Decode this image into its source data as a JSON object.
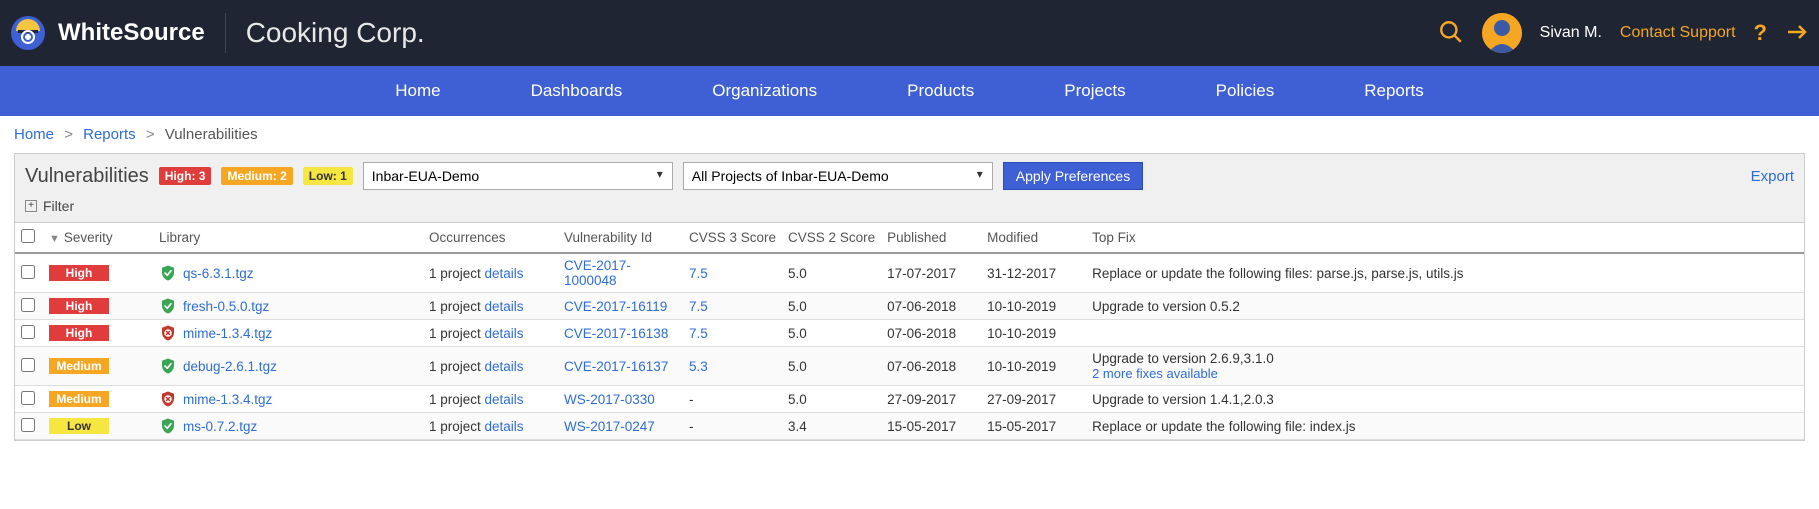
{
  "topbar": {
    "brand": "WhiteSource",
    "org": "Cooking Corp.",
    "username": "Sivan M.",
    "contact": "Contact Support"
  },
  "nav": {
    "items": [
      "Home",
      "Dashboards",
      "Organizations",
      "Products",
      "Projects",
      "Policies",
      "Reports"
    ]
  },
  "breadcrumb": {
    "items": [
      "Home",
      "Reports",
      "Vulnerabilities"
    ]
  },
  "header": {
    "title": "Vulnerabilities",
    "sev_counts": {
      "high": "High: 3",
      "medium": "Medium: 2",
      "low": "Low: 1"
    },
    "select_product": "Inbar-EUA-Demo",
    "select_project": "All Projects of Inbar-EUA-Demo",
    "apply": "Apply Preferences",
    "export": "Export",
    "filter": "Filter"
  },
  "columns": {
    "checkbox": "",
    "severity": "Severity",
    "library": "Library",
    "occurrences": "Occurrences",
    "vuln_id": "Vulnerability Id",
    "cvss3": "CVSS 3 Score",
    "cvss2": "CVSS 2 Score",
    "published": "Published",
    "modified": "Modified",
    "topfix": "Top Fix"
  },
  "labels": {
    "project_prefix": "1 project ",
    "details": "details"
  },
  "rows": [
    {
      "severity": "High",
      "shield": "green",
      "library": "qs-6.3.1.tgz",
      "vuln_id": "CVE-2017-1000048",
      "cvss3": "7.5",
      "cvss2": "5.0",
      "published": "17-07-2017",
      "modified": "31-12-2017",
      "topfix": "Replace or update the following files: parse.js, parse.js, utils.js",
      "morefix": ""
    },
    {
      "severity": "High",
      "shield": "green",
      "library": "fresh-0.5.0.tgz",
      "vuln_id": "CVE-2017-16119",
      "cvss3": "7.5",
      "cvss2": "5.0",
      "published": "07-06-2018",
      "modified": "10-10-2019",
      "topfix": "Upgrade to version 0.5.2",
      "morefix": ""
    },
    {
      "severity": "High",
      "shield": "red",
      "library": "mime-1.3.4.tgz",
      "vuln_id": "CVE-2017-16138",
      "cvss3": "7.5",
      "cvss2": "5.0",
      "published": "07-06-2018",
      "modified": "10-10-2019",
      "topfix": "",
      "morefix": ""
    },
    {
      "severity": "Medium",
      "shield": "green",
      "library": "debug-2.6.1.tgz",
      "vuln_id": "CVE-2017-16137",
      "cvss3": "5.3",
      "cvss2": "5.0",
      "published": "07-06-2018",
      "modified": "10-10-2019",
      "topfix": "Upgrade to version 2.6.9,3.1.0",
      "morefix": "2 more fixes available"
    },
    {
      "severity": "Medium",
      "shield": "red",
      "library": "mime-1.3.4.tgz",
      "vuln_id": "WS-2017-0330",
      "cvss3": "-",
      "cvss2": "5.0",
      "published": "27-09-2017",
      "modified": "27-09-2017",
      "topfix": "Upgrade to version 1.4.1,2.0.3",
      "morefix": ""
    },
    {
      "severity": "Low",
      "shield": "green",
      "library": "ms-0.7.2.tgz",
      "vuln_id": "WS-2017-0247",
      "cvss3": "-",
      "cvss2": "3.4",
      "published": "15-05-2017",
      "modified": "15-05-2017",
      "topfix": "Replace or update the following file: index.js",
      "morefix": ""
    }
  ]
}
